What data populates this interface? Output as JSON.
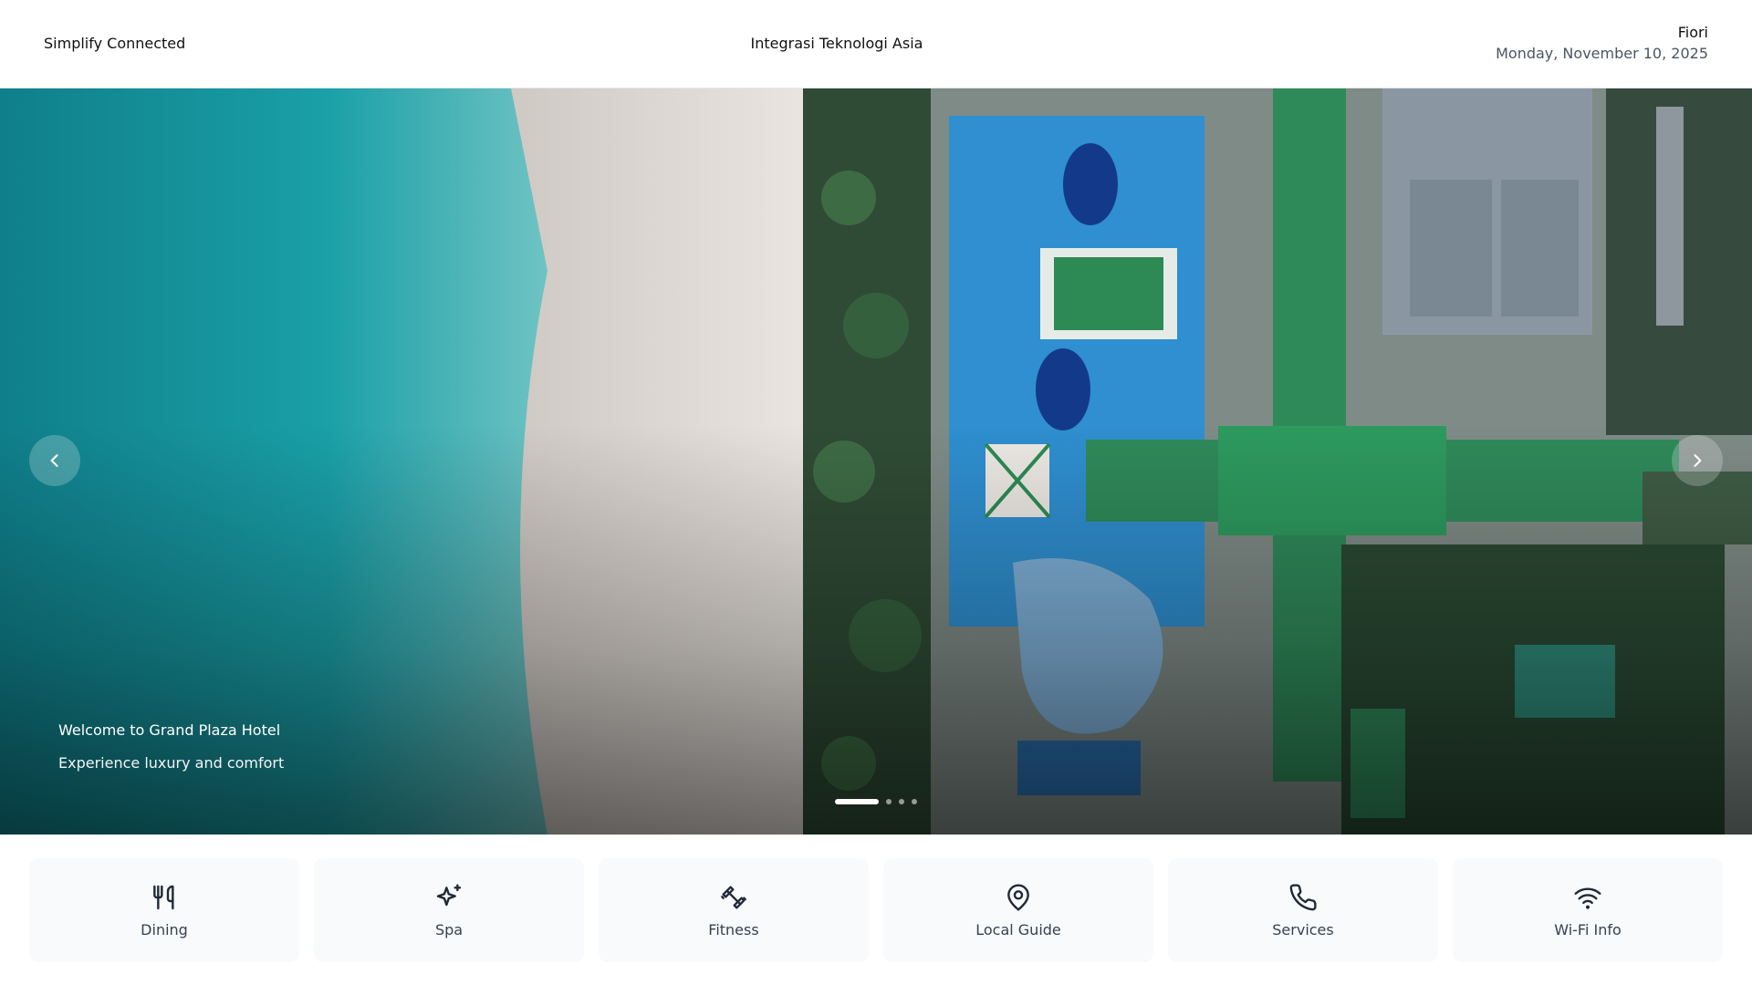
{
  "header": {
    "brand": "Simplify Connected",
    "center_title": "Integrasi Teknologi Asia",
    "user_name": "Fiori",
    "date": "Monday, November 10, 2025"
  },
  "hero": {
    "title": "Welcome to Grand Plaza Hotel",
    "subtitle": "Experience luxury and comfort",
    "prev_icon": "chevron-left-icon",
    "next_icon": "chevron-right-icon",
    "slides_total": 4,
    "active_slide": 1
  },
  "tiles": [
    {
      "label": "Dining",
      "icon": "utensils-icon"
    },
    {
      "label": "Spa",
      "icon": "sparkles-icon"
    },
    {
      "label": "Fitness",
      "icon": "dumbbell-icon"
    },
    {
      "label": "Local Guide",
      "icon": "map-pin-icon"
    },
    {
      "label": "Services",
      "icon": "phone-icon"
    },
    {
      "label": "Wi-Fi Info",
      "icon": "wifi-icon"
    }
  ],
  "colors": {
    "header_bg": "#ffffff",
    "tile_bg": "#f8fafc",
    "tile_text": "#374151",
    "icon_stroke": "#1f2937",
    "sea": "#0e8a95",
    "sand": "#e8e2dc",
    "pool": "#2f8fd0",
    "roof_green": "#2f8a5a"
  }
}
